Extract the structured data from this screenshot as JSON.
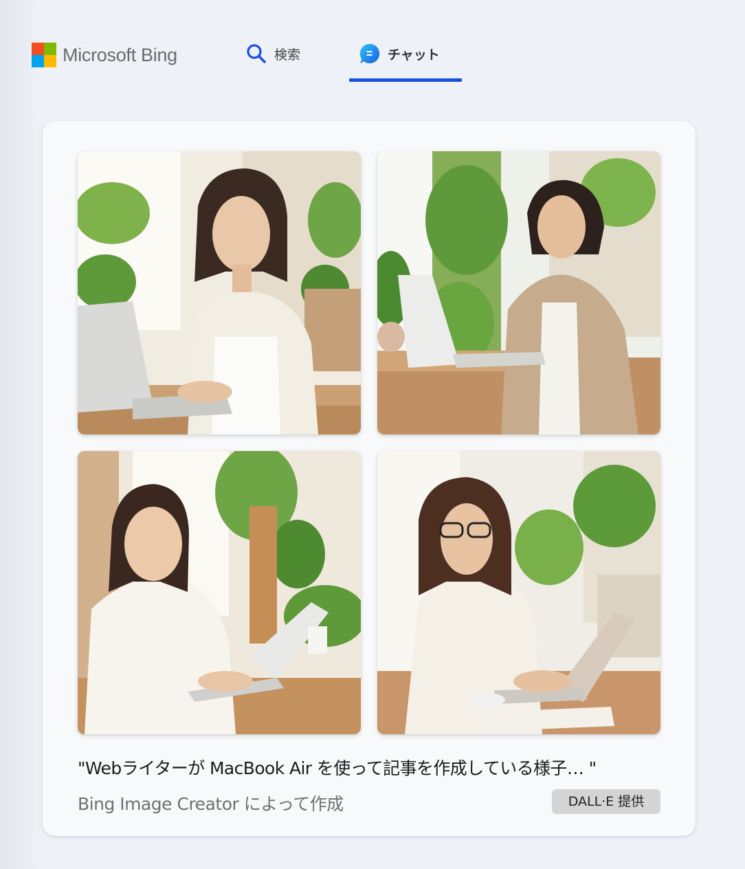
{
  "header": {
    "brand": "Microsoft Bing",
    "brand_colors": [
      "#f25022",
      "#7fba00",
      "#00a4ef",
      "#ffb900"
    ],
    "tabs": [
      {
        "label": "検索",
        "icon": "search-icon",
        "active": false
      },
      {
        "label": "チャット",
        "icon": "chat-icon",
        "active": true
      }
    ],
    "accent": "#1a4fe0"
  },
  "card": {
    "images": [
      {
        "icon": "generated-image"
      },
      {
        "icon": "generated-image"
      },
      {
        "icon": "generated-image"
      },
      {
        "icon": "generated-image"
      }
    ],
    "prompt": "\"Webライターが MacBook Air を使って記事を作成している様子… \"",
    "creator": "Bing Image Creator によって作成",
    "badge": "DALL·E 提供"
  }
}
